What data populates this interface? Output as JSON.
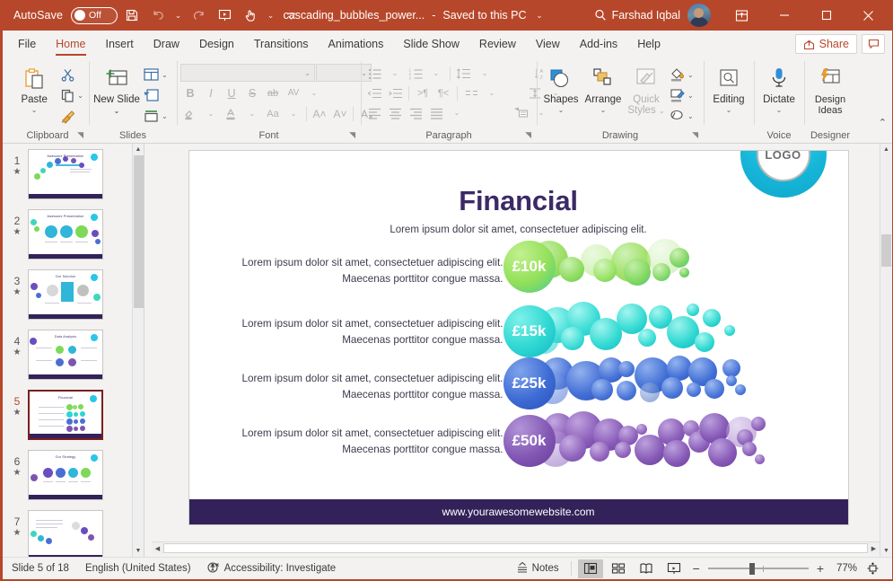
{
  "titlebar": {
    "autosave_label": "AutoSave",
    "autosave_state": "Off",
    "doc_title": "cascading_bubbles_power...",
    "separator": "-",
    "saved_state": "Saved to this PC",
    "username": "Farshad Iqbal",
    "icons": {
      "save": "save-icon",
      "undo": "undo-icon",
      "redo": "redo-icon",
      "present": "start-presentation-icon",
      "touch": "touch-mode-icon",
      "customize": "customize-quick-access-icon",
      "search": "search-icon",
      "ribbon_display": "ribbon-display-options-icon",
      "minimize": "minimize-icon",
      "maximize": "maximize-icon",
      "close": "close-icon"
    }
  },
  "tabs": [
    {
      "label": "File",
      "active": false
    },
    {
      "label": "Home",
      "active": true
    },
    {
      "label": "Insert",
      "active": false
    },
    {
      "label": "Draw",
      "active": false
    },
    {
      "label": "Design",
      "active": false
    },
    {
      "label": "Transitions",
      "active": false
    },
    {
      "label": "Animations",
      "active": false
    },
    {
      "label": "Slide Show",
      "active": false
    },
    {
      "label": "Review",
      "active": false
    },
    {
      "label": "View",
      "active": false
    },
    {
      "label": "Add-ins",
      "active": false
    },
    {
      "label": "Help",
      "active": false
    }
  ],
  "share": {
    "label": "Share",
    "comment_icon": "comment-icon"
  },
  "ribbon": {
    "groups": [
      {
        "name": "Clipboard",
        "label": "Clipboard",
        "items": {
          "paste": "Paste",
          "cut": "cut-icon",
          "copy": "copy-icon",
          "format_painter": "format-painter-icon"
        }
      },
      {
        "name": "Slides",
        "label": "Slides",
        "items": {
          "new_slide": "New Slide",
          "layout": "layout-icon",
          "reset": "reset-icon",
          "section": "section-icon"
        }
      },
      {
        "name": "Font",
        "label": "Font",
        "font_name": "",
        "font_size": "",
        "buttons": [
          "B",
          "I",
          "U",
          "S",
          "ab",
          "AV"
        ],
        "row2": [
          "text-highlight-icon",
          "font-color-icon",
          "Aa",
          "A˄",
          "A˅",
          "clear-formatting-icon"
        ]
      },
      {
        "name": "Paragraph",
        "label": "Paragraph"
      },
      {
        "name": "Drawing",
        "label": "Drawing",
        "shapes": "Shapes",
        "arrange": "Arrange",
        "quick_styles": "Quick Styles"
      },
      {
        "name": "Editing",
        "label": "",
        "editing": "Editing"
      },
      {
        "name": "Voice",
        "label": "Voice",
        "dictate": "Dictate"
      },
      {
        "name": "Designer",
        "label": "Designer",
        "design_ideas": "Design Ideas"
      }
    ],
    "collapse_icon": "collapse-ribbon-icon"
  },
  "thumbnails": [
    {
      "number": "1",
      "selected": false,
      "animated": true
    },
    {
      "number": "2",
      "selected": false,
      "animated": true
    },
    {
      "number": "3",
      "selected": false,
      "animated": true
    },
    {
      "number": "4",
      "selected": false,
      "animated": true
    },
    {
      "number": "5",
      "selected": true,
      "animated": true
    },
    {
      "number": "6",
      "selected": false,
      "animated": true
    },
    {
      "number": "7",
      "selected": false,
      "animated": true
    }
  ],
  "slide": {
    "title": "Financial",
    "subtitle": "Lorem ipsum dolor sit amet, consectetuer adipiscing elit.",
    "logo_text": "LOGO",
    "footer_url": "www.yourawesomewebsite.com",
    "body_text": "Lorem ipsum dolor sit amet, consectetuer adipiscing elit. Maecenas porttitor congue massa.",
    "rows": [
      {
        "value": "£10k",
        "color": "#7ed957",
        "color2": "#35c98f",
        "text": "Lorem ipsum dolor sit amet, consectetuer adipiscing elit. Maecenas porttitor congue massa."
      },
      {
        "value": "£15k",
        "color": "#2fd5d0",
        "color2": "#1ab8c4",
        "text": "Lorem ipsum dolor sit amet, consectetuer adipiscing elit. Maecenas porttitor congue massa."
      },
      {
        "value": "£25k",
        "color": "#4a6fd4",
        "color2": "#3558c0",
        "text": "Lorem ipsum dolor sit amet, consectetuer adipiscing elit. Maecenas porttitor congue massa."
      },
      {
        "value": "£50k",
        "color": "#7d55b0",
        "color2": "#6a3f9e",
        "text": "Lorem ipsum dolor sit amet, consectetuer adipiscing elit. Maecenas porttitor congue massa."
      }
    ]
  },
  "statusbar": {
    "slide_counter": "Slide 5 of 18",
    "language": "English (United States)",
    "accessibility": "Accessibility: Investigate",
    "notes": "Notes",
    "zoom_percent": "77%",
    "views": [
      "normal-view-icon",
      "slide-sorter-icon",
      "reading-view-icon",
      "slide-show-icon"
    ],
    "fit_icon": "fit-slide-to-window-icon",
    "zoom_out": "−",
    "zoom_in": "+"
  },
  "colors": {
    "accent": "#b7472a",
    "slide_purple": "#332259",
    "logo_cyan": "#16b6d8"
  }
}
